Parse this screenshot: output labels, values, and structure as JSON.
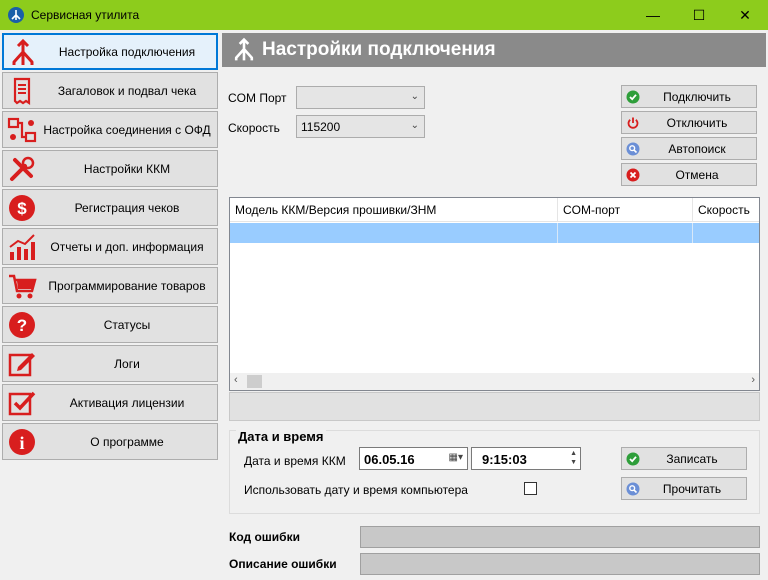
{
  "window": {
    "title": "Сервисная утилита",
    "minimize": "—",
    "maximize": "☐",
    "close": "✕",
    "accent": "#8dcc1c"
  },
  "sidebar": {
    "items": [
      {
        "label": "Настройка подключения",
        "icon": "connection-fork-icon",
        "active": true
      },
      {
        "label": "Загаловок и подвал чека",
        "icon": "receipt-icon"
      },
      {
        "label": "Настройка соединения с ОФД",
        "icon": "network-icon"
      },
      {
        "label": "Настройки ККМ",
        "icon": "tools-icon"
      },
      {
        "label": "Регистрация чеков",
        "icon": "dollar-icon"
      },
      {
        "label": "Отчеты и доп. информация",
        "icon": "chart-icon"
      },
      {
        "label": "Программирование товаров",
        "icon": "cart-icon"
      },
      {
        "label": "Статусы",
        "icon": "question-icon"
      },
      {
        "label": "Логи",
        "icon": "edit-icon"
      },
      {
        "label": "Активация лицензии",
        "icon": "checkbox-icon"
      },
      {
        "label": "О программе",
        "icon": "info-icon"
      }
    ]
  },
  "header": {
    "title": "Настройки подключения"
  },
  "connection": {
    "com_label": "COM Порт",
    "com_value": "",
    "speed_label": "Скорость",
    "speed_value": "115200"
  },
  "buttons": {
    "connect": "Подключить",
    "disconnect": "Отключить",
    "autosearch": "Автопоиск",
    "cancel": "Отмена"
  },
  "table": {
    "columns": [
      "Модель ККМ/Версия прошивки/ЗНМ",
      "COM-порт",
      "Скорость"
    ]
  },
  "datetime": {
    "group_title": "Дата и время",
    "label": "Дата и время ККМ",
    "date": "06.05.16",
    "time": "9:15:03",
    "use_pc_label": "Использовать дату и время компьютера",
    "write_button": "Записать",
    "read_button": "Прочитать"
  },
  "errors": {
    "code_label": "Код ошибки",
    "desc_label": "Описание ошибки",
    "code_value": "",
    "desc_value": ""
  }
}
